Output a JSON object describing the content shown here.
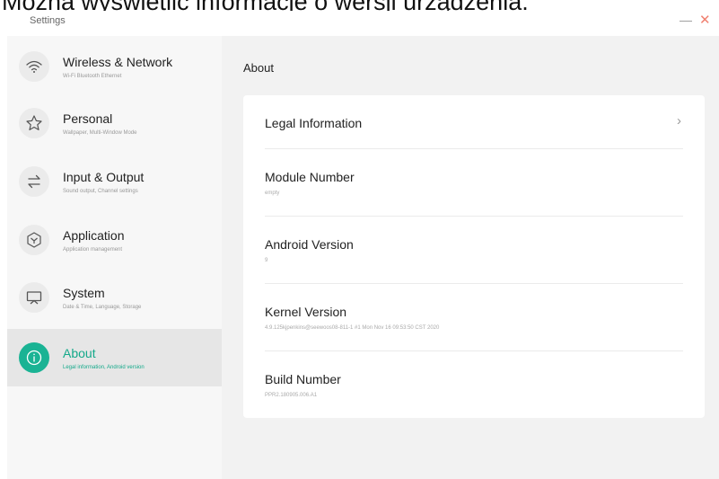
{
  "caption": "Można wyświetlić informacje o wersji urządzenia.",
  "window": {
    "title": "Settings",
    "minimize_label": "—",
    "close_label": "✕"
  },
  "sidebar": {
    "items": [
      {
        "title": "Wireless & Network",
        "subtitle": "Wi-Fi Bluetooth Ethernet",
        "icon": "wifi-icon",
        "active": false
      },
      {
        "title": "Personal",
        "subtitle": "Wallpaper, Multi-Window Mode",
        "icon": "star-icon",
        "active": false
      },
      {
        "title": "Input & Output",
        "subtitle": "Sound output, Channel settings",
        "icon": "swap-arrows-icon",
        "active": false
      },
      {
        "title": "Application",
        "subtitle": "Application management",
        "icon": "cube-icon",
        "active": false
      },
      {
        "title": "System",
        "subtitle": "Date & Time, Language, Storage",
        "icon": "monitor-icon",
        "active": false
      },
      {
        "title": "About",
        "subtitle": "Legal information, Android version",
        "icon": "info-icon",
        "active": true
      }
    ]
  },
  "main": {
    "title": "About",
    "rows": [
      {
        "title": "Legal Information",
        "value": ""
      },
      {
        "title": "Module Number",
        "value": "empty"
      },
      {
        "title": "Android Version",
        "value": "9"
      },
      {
        "title": "Kernel Version",
        "value": "4.9.125kjpenkins@seewoos08-811-1 #1  Mon Nov 16 09:53:50 CST 2020"
      },
      {
        "title": "Build Number",
        "value": "PPR2.180905.006.A1"
      }
    ],
    "chevron": "›"
  },
  "colors": {
    "accent": "#1ab394",
    "sidebar_bg": "#f7f7f7",
    "active_bg": "#e6e6e6",
    "main_bg": "#f2f2f2"
  }
}
